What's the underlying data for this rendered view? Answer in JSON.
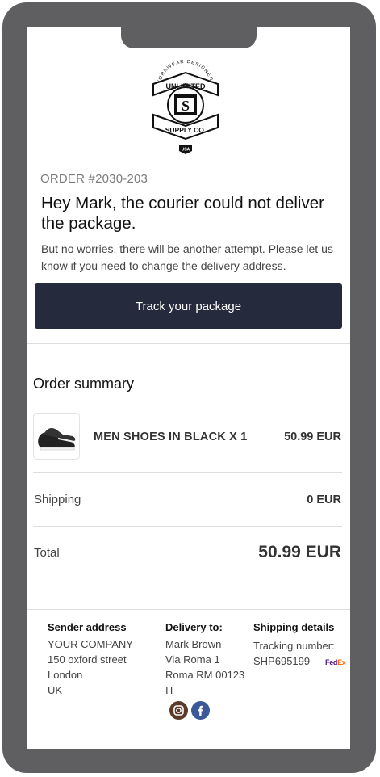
{
  "brand": {
    "logo_arc_top": "WORKWEAR DESIGNERS",
    "logo_banner_top": "UNLIMITED",
    "logo_monogram": "S",
    "logo_banner_bottom": "SUPPLY CO.",
    "logo_badge": "USA"
  },
  "order": {
    "number": "ORDER #2030-203"
  },
  "message": {
    "headline": "Hey Mark, the courier could not deliver the package.",
    "body": "But no worries, there will be another attempt. Please let us know if you need to change the delivery address."
  },
  "cta": {
    "label": "Track your package"
  },
  "summary": {
    "title": "Order summary",
    "item": {
      "name": "MEN SHOES IN BLACK X 1",
      "price": "50.99 EUR",
      "icon": "shoe-thumbnail"
    },
    "shipping_label": "Shipping",
    "shipping_value": "0 EUR",
    "total_label": "Total",
    "total_value": "50.99 EUR"
  },
  "footer": {
    "sender": {
      "title": "Sender address",
      "lines": [
        "YOUR COMPANY",
        "150 oxford street",
        "London",
        "UK"
      ]
    },
    "delivery": {
      "title": "Delivery to:",
      "lines": [
        "Mark Brown",
        "Via Roma 1",
        "Roma RM 00123",
        "IT"
      ]
    },
    "shipping": {
      "title": "Shipping details",
      "tracking_label": "Tracking number:",
      "tracking_number": "SHP695199",
      "carrier_fed": "Fed",
      "carrier_ex": "Ex"
    },
    "social": [
      "instagram-icon",
      "facebook-icon"
    ]
  },
  "colors": {
    "frame": "#5f5f61",
    "button": "#262a3d",
    "fedex_purple": "#4d148c",
    "fedex_orange": "#ff6600",
    "instagram": "#5b3a29",
    "facebook": "#3b5998"
  }
}
